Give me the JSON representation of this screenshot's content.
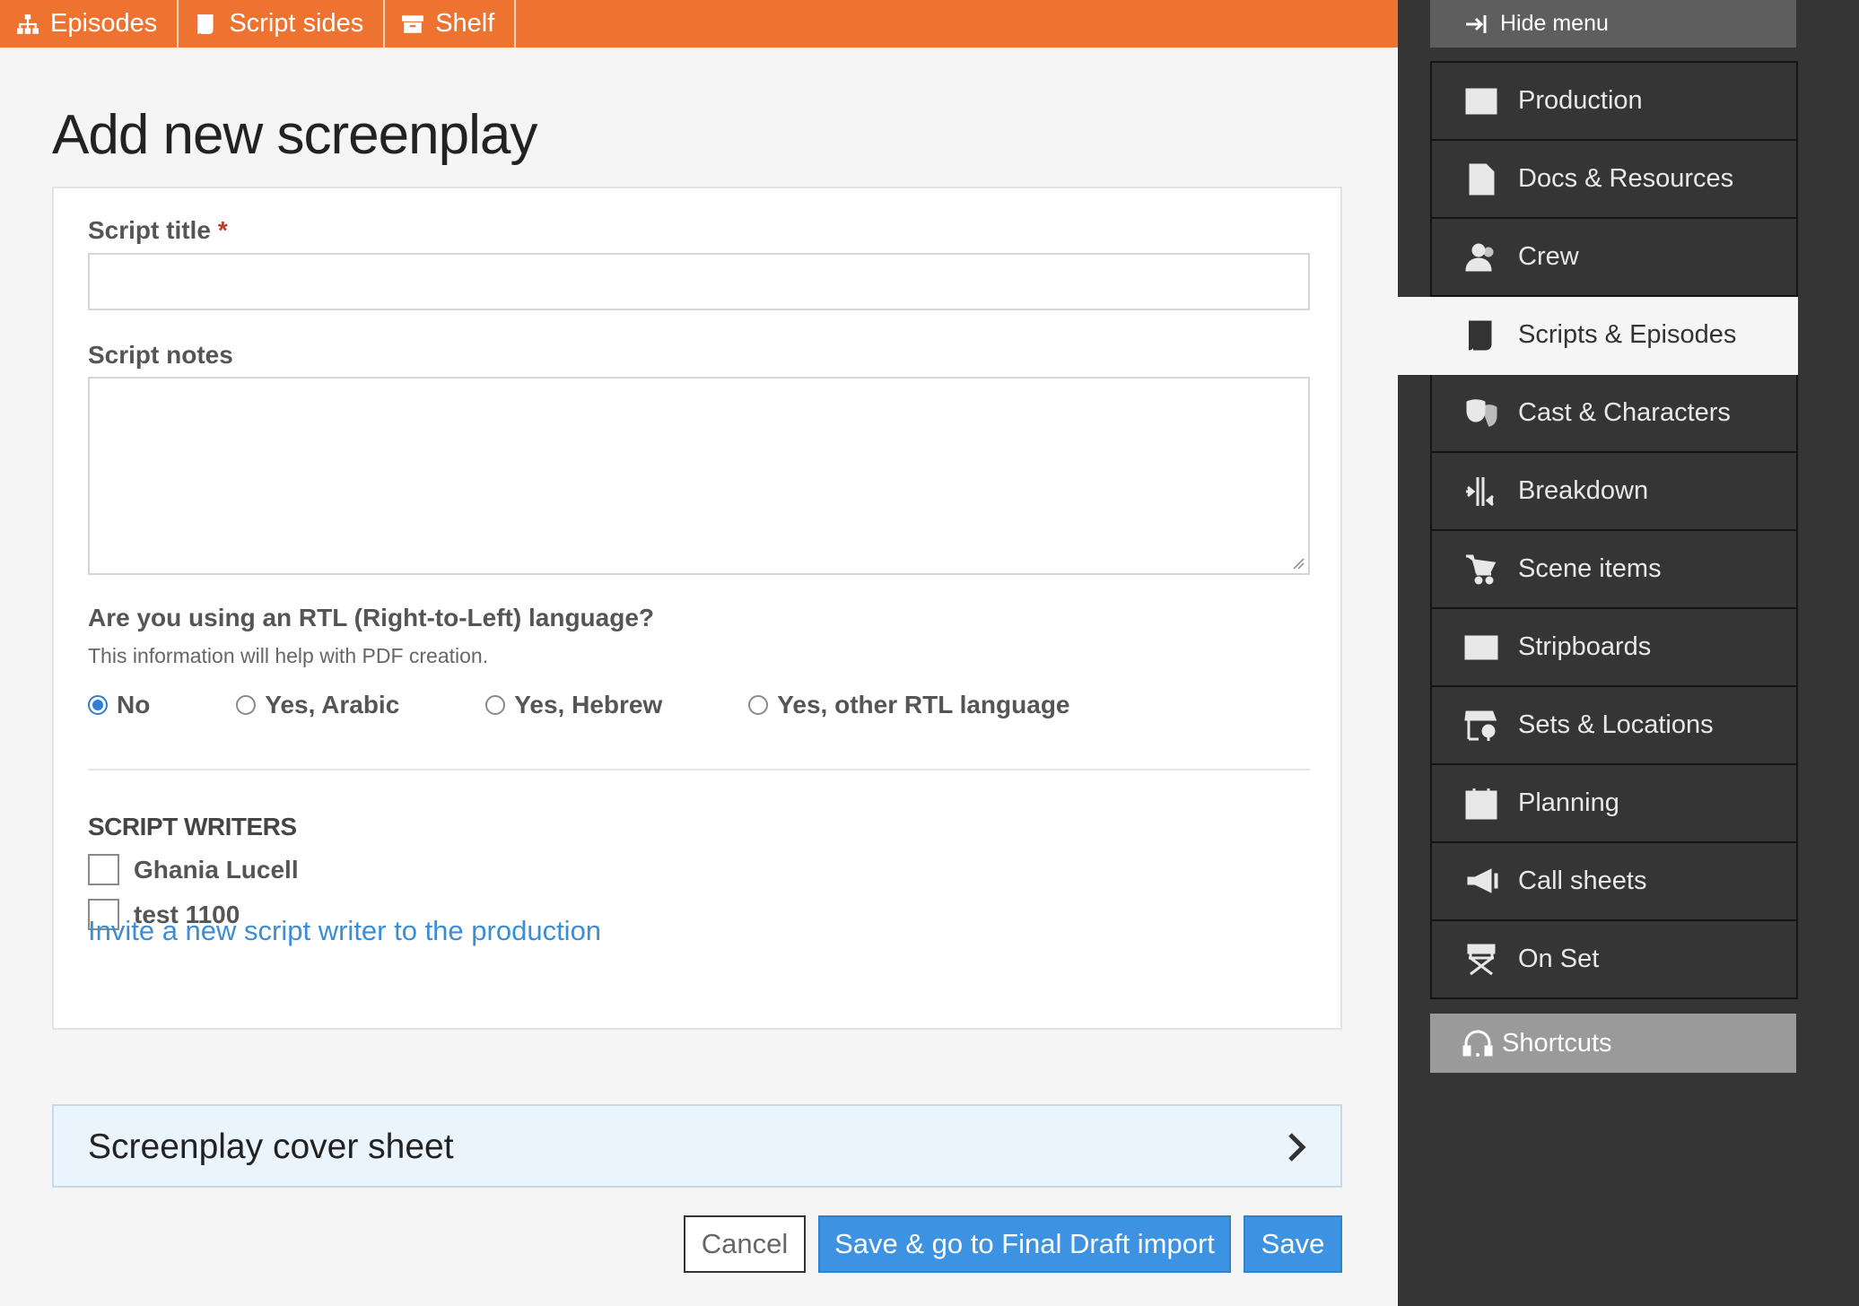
{
  "topbar": {
    "tabs": [
      {
        "label": "Episodes",
        "icon": "sitemap-icon"
      },
      {
        "label": "Script sides",
        "icon": "script-icon"
      },
      {
        "label": "Shelf",
        "icon": "archive-icon"
      }
    ],
    "color": "#ee7330"
  },
  "page": {
    "title": "Add new screenplay"
  },
  "form": {
    "script_title_label": "Script title",
    "required_mark": "*",
    "script_title_value": "",
    "script_notes_label": "Script notes",
    "script_notes_value": "",
    "rtl_question": "Are you using an RTL (Right-to-Left) language?",
    "rtl_help": "This information will help with PDF creation.",
    "rtl_options": [
      {
        "label": "No",
        "selected": true
      },
      {
        "label": "Yes, Arabic",
        "selected": false
      },
      {
        "label": "Yes, Hebrew",
        "selected": false
      },
      {
        "label": "Yes, other RTL language",
        "selected": false
      }
    ],
    "writers_heading": "SCRIPT WRITERS",
    "writers": [
      {
        "name": "Ghania Lucell",
        "checked": false
      },
      {
        "name": "test 1100",
        "checked": false
      }
    ],
    "invite_link": "Invite a new script writer to the production"
  },
  "cover_sheet": {
    "label": "Screenplay cover sheet"
  },
  "buttons": {
    "cancel": "Cancel",
    "save_final_draft": "Save & go to Final Draft import",
    "save": "Save"
  },
  "sidebar": {
    "hide_menu": "Hide menu",
    "items": [
      {
        "label": "Production",
        "icon": "film-icon",
        "active": false
      },
      {
        "label": "Docs & Resources",
        "icon": "document-icon",
        "active": false
      },
      {
        "label": "Crew",
        "icon": "crew-icon",
        "active": false
      },
      {
        "label": "Scripts & Episodes",
        "icon": "script-icon",
        "active": true
      },
      {
        "label": "Cast & Characters",
        "icon": "masks-icon",
        "active": false
      },
      {
        "label": "Breakdown",
        "icon": "breakdown-icon",
        "active": false
      },
      {
        "label": "Scene items",
        "icon": "cart-icon",
        "active": false
      },
      {
        "label": "Stripboards",
        "icon": "stripboard-icon",
        "active": false
      },
      {
        "label": "Sets & Locations",
        "icon": "location-icon",
        "active": false
      },
      {
        "label": "Planning",
        "icon": "calendar-icon",
        "active": false
      },
      {
        "label": "Call sheets",
        "icon": "megaphone-icon",
        "active": false
      },
      {
        "label": "On Set",
        "icon": "directors-chair-icon",
        "active": false
      }
    ],
    "shortcuts": "Shortcuts"
  }
}
